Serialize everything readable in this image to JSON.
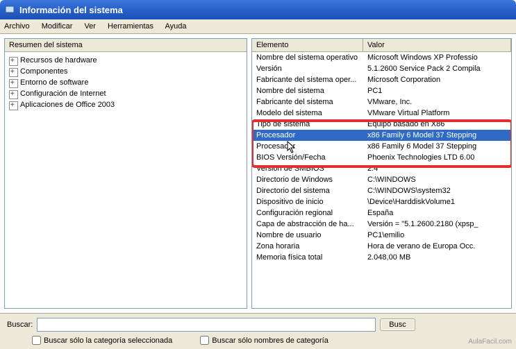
{
  "window": {
    "title": "Información del sistema"
  },
  "menu": {
    "file": "Archivo",
    "edit": "Modificar",
    "view": "Ver",
    "tools": "Herramientas",
    "help": "Ayuda"
  },
  "tree": {
    "header": "Resumen del sistema",
    "items": [
      {
        "label": "Recursos de hardware"
      },
      {
        "label": "Componentes"
      },
      {
        "label": "Entorno de software"
      },
      {
        "label": "Configuración de Internet"
      },
      {
        "label": "Aplicaciones de Office 2003"
      }
    ]
  },
  "detail": {
    "col_element": "Elemento",
    "col_value": "Valor",
    "rows": [
      {
        "name": "Nombre del sistema operativo",
        "value": "Microsoft Windows XP Professio"
      },
      {
        "name": "Versión",
        "value": "5.1.2600 Service Pack 2 Compila"
      },
      {
        "name": "Fabricante del sistema oper...",
        "value": "Microsoft Corporation"
      },
      {
        "name": "Nombre del sistema",
        "value": "PC1"
      },
      {
        "name": "Fabricante del sistema",
        "value": "VMware, Inc."
      },
      {
        "name": "Modelo del sistema",
        "value": "VMware Virtual Platform"
      },
      {
        "name": "Tipo de sistema",
        "value": "Equipo basado en X86"
      },
      {
        "name": "Procesador",
        "value": "x86 Family 6 Model 37 Stepping",
        "selected": true
      },
      {
        "name": "Procesador",
        "value": "x86 Family 6 Model 37 Stepping"
      },
      {
        "name": "BIOS Versión/Fecha",
        "value": "Phoenix Technologies LTD 6.00"
      },
      {
        "name": "Versión de SMBIOS",
        "value": "2.4"
      },
      {
        "name": "Directorio de Windows",
        "value": "C:\\WINDOWS"
      },
      {
        "name": "Directorio del sistema",
        "value": "C:\\WINDOWS\\system32"
      },
      {
        "name": "Dispositivo de inicio",
        "value": "\\Device\\HarddiskVolume1"
      },
      {
        "name": "Configuración regional",
        "value": "España"
      },
      {
        "name": "Capa de abstracción de ha...",
        "value": "Versión = \"5.1.2600.2180 (xpsp_"
      },
      {
        "name": "Nombre de usuario",
        "value": "PC1\\emilio"
      },
      {
        "name": "Zona horaria",
        "value": "Hora de verano de Europa Occ."
      },
      {
        "name": "Memoria física total",
        "value": "2.048,00 MB"
      }
    ]
  },
  "search": {
    "label": "Buscar:",
    "value": "",
    "find_btn": "Busc",
    "chk_category": "Buscar sólo la categoría seleccionada",
    "chk_names": "Buscar sólo nombres de categoría"
  },
  "watermark": "AulaFacil.com"
}
